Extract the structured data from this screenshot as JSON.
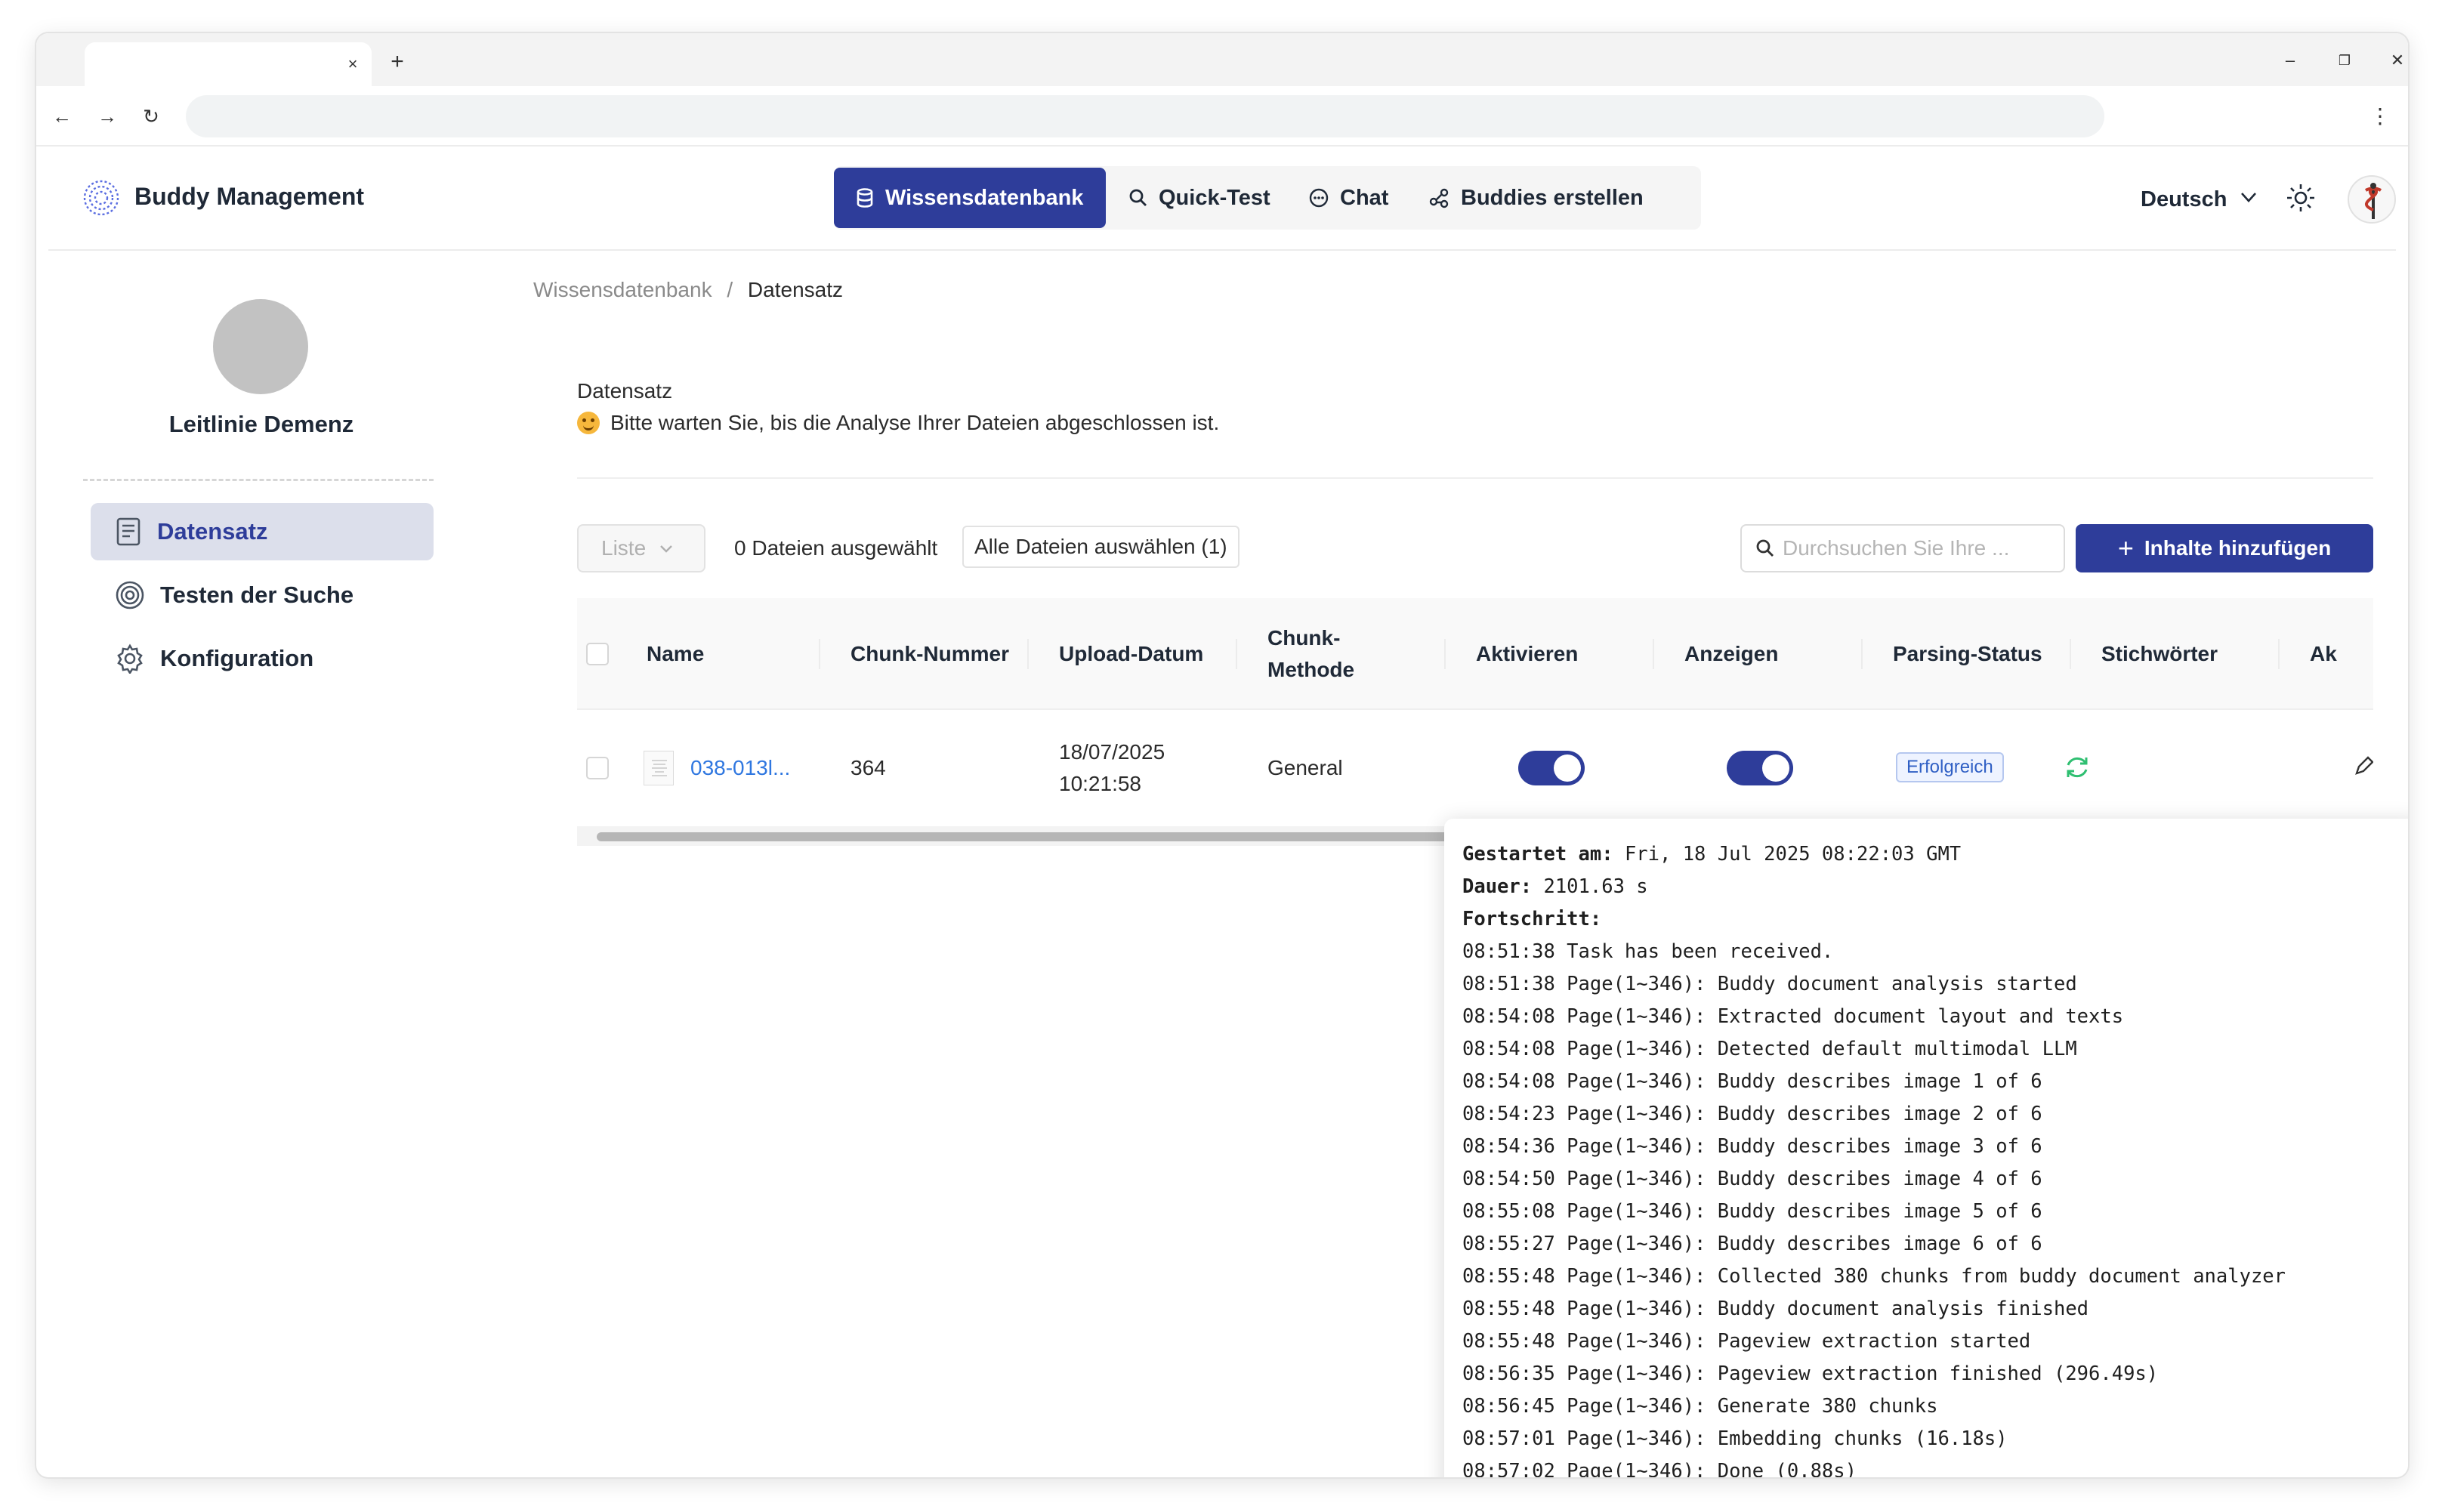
{
  "browser": {
    "tab_close": "×",
    "new_tab": "+",
    "minimize": "–",
    "restore": "❐",
    "close": "✕",
    "back": "←",
    "forward": "→",
    "reload": "↻",
    "menu": "⋮"
  },
  "header": {
    "brand": "Buddy Management",
    "nav": [
      {
        "label": "Wissensdatenbank",
        "icon": "database-icon",
        "active": true
      },
      {
        "label": "Quick-Test",
        "icon": "search-icon",
        "active": false
      },
      {
        "label": "Chat",
        "icon": "chat-bubble-icon",
        "active": false
      },
      {
        "label": "Buddies erstellen",
        "icon": "workflow-icon",
        "active": false
      }
    ],
    "language": "Deutsch"
  },
  "sidebar": {
    "title": "Leitlinie Demenz",
    "items": [
      {
        "label": "Datensatz",
        "icon": "document-icon",
        "active": true
      },
      {
        "label": "Testen der Suche",
        "icon": "target-icon",
        "active": false
      },
      {
        "label": "Konfiguration",
        "icon": "gear-icon",
        "active": false
      }
    ]
  },
  "breadcrumb": {
    "root": "Wissensdatenbank",
    "separator": "/",
    "current": "Datensatz"
  },
  "main": {
    "section_title": "Datensatz",
    "notice": "Bitte warten Sie, bis die Analyse Ihrer Dateien abgeschlossen ist.",
    "view_select": "Liste",
    "selected_count": "0 Dateien ausgewählt",
    "select_all": "Alle Dateien auswählen (1)",
    "search_placeholder": "Durchsuchen Sie Ihre ...",
    "add_button": "Inhalte hinzufügen"
  },
  "table": {
    "headers": {
      "name": "Name",
      "chunk_number": "Chunk-Nummer",
      "upload_date": "Upload-Datum",
      "chunk_method_1": "Chunk-",
      "chunk_method_2": "Methode",
      "activate": "Aktivieren",
      "show": "Anzeigen",
      "parsing_status": "Parsing-Status",
      "keywords": "Stichwörter",
      "actions": "Ak"
    },
    "rows": [
      {
        "name": "038-013l...",
        "chunk_number": "364",
        "upload_date_1": "18/07/2025",
        "upload_date_2": "10:21:58",
        "chunk_method": "General",
        "activated": true,
        "shown": true,
        "status": "Erfolgreich"
      }
    ]
  },
  "tooltip": {
    "started_label": "Gestartet am:",
    "started_value": " Fri, 18 Jul 2025 08:22:03 GMT",
    "duration_label": "Dauer:",
    "duration_value": " 2101.63 s",
    "progress_label": "Fortschritt:",
    "log": [
      "08:51:38 Task has been received.",
      "08:51:38 Page(1~346): Buddy document analysis started",
      "08:54:08 Page(1~346): Extracted document layout and texts",
      "08:54:08 Page(1~346): Detected default multimodal LLM",
      "08:54:08 Page(1~346): Buddy describes image 1 of 6",
      "08:54:23 Page(1~346): Buddy describes image 2 of 6",
      "08:54:36 Page(1~346): Buddy describes image 3 of 6",
      "08:54:50 Page(1~346): Buddy describes image 4 of 6",
      "08:55:08 Page(1~346): Buddy describes image 5 of 6",
      "08:55:27 Page(1~346): Buddy describes image 6 of 6",
      "08:55:48 Page(1~346): Collected 380 chunks from buddy document analyzer",
      "08:55:48 Page(1~346): Buddy document analysis finished",
      "08:55:48 Page(1~346): Pageview extraction started",
      "08:56:35 Page(1~346): Pageview extraction finished (296.49s)",
      "08:56:45 Page(1~346): Generate 380 chunks",
      "08:57:01 Page(1~346): Embedding chunks (16.18s)",
      "08:57:02 Page(1~346): Done (0.88s)"
    ]
  },
  "colors": {
    "primary": "#2e3d9a",
    "link": "#2f77e0",
    "success": "#2fbf71"
  }
}
